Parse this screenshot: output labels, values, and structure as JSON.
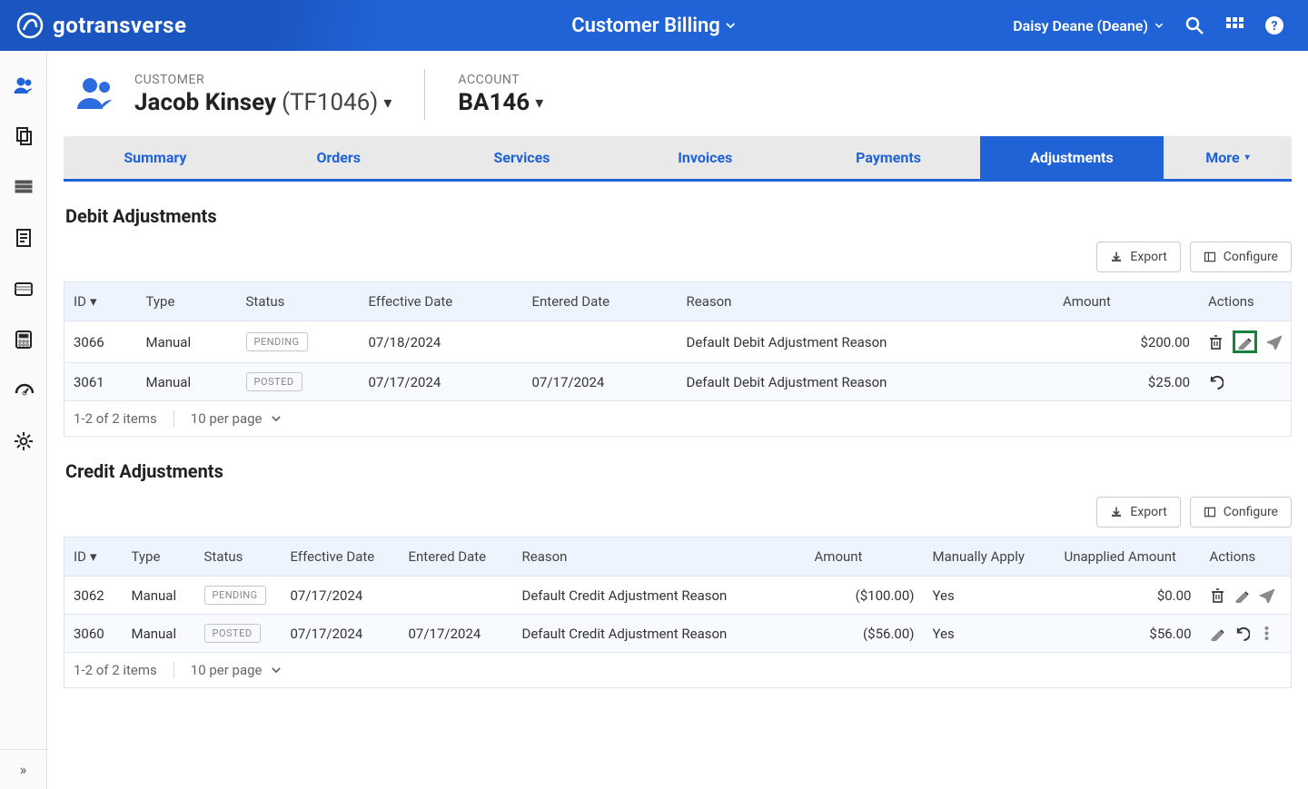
{
  "header": {
    "brand": "gotransverse",
    "section": "Customer Billing",
    "user": "Daisy Deane (Deane)"
  },
  "page": {
    "customer_label": "CUSTOMER",
    "customer_name": "Jacob Kinsey",
    "customer_paren": "(TF1046)",
    "account_label": "ACCOUNT",
    "account_value": "BA146"
  },
  "tabs": {
    "summary": "Summary",
    "orders": "Orders",
    "services": "Services",
    "invoices": "Invoices",
    "payments": "Payments",
    "adjustments": "Adjustments",
    "more": "More"
  },
  "buttons": {
    "export": "Export",
    "configure": "Configure"
  },
  "columns": {
    "id": "ID",
    "type": "Type",
    "status": "Status",
    "effective": "Effective Date",
    "entered": "Entered Date",
    "reason": "Reason",
    "amount": "Amount",
    "manually_apply": "Manually Apply",
    "unapplied": "Unapplied Amount",
    "actions": "Actions"
  },
  "debit": {
    "title": "Debit Adjustments",
    "rows": [
      {
        "id": "3066",
        "type": "Manual",
        "status": "PENDING",
        "effective": "07/18/2024",
        "entered": "",
        "reason": "Default Debit Adjustment Reason",
        "amount": "$200.00"
      },
      {
        "id": "3061",
        "type": "Manual",
        "status": "POSTED",
        "effective": "07/17/2024",
        "entered": "07/17/2024",
        "reason": "Default Debit Adjustment Reason",
        "amount": "$25.00"
      }
    ],
    "pager_count": "1-2 of 2 items",
    "pager_pp": "10 per page"
  },
  "credit": {
    "title": "Credit Adjustments",
    "rows": [
      {
        "id": "3062",
        "type": "Manual",
        "status": "PENDING",
        "effective": "07/17/2024",
        "entered": "",
        "reason": "Default Credit Adjustment Reason",
        "amount": "($100.00)",
        "manually": "Yes",
        "unapplied": "$0.00"
      },
      {
        "id": "3060",
        "type": "Manual",
        "status": "POSTED",
        "effective": "07/17/2024",
        "entered": "07/17/2024",
        "reason": "Default Credit Adjustment Reason",
        "amount": "($56.00)",
        "manually": "Yes",
        "unapplied": "$56.00"
      }
    ],
    "pager_count": "1-2 of 2 items",
    "pager_pp": "10 per page"
  }
}
